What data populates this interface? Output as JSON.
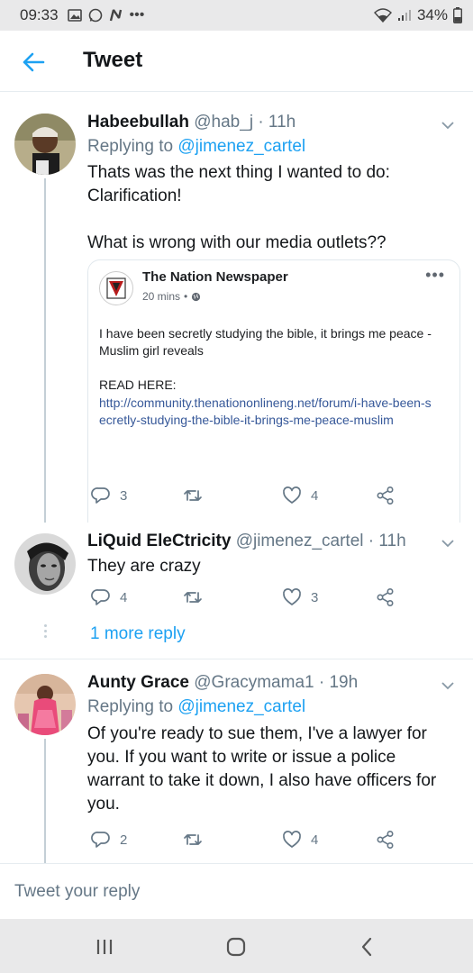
{
  "status_bar": {
    "time": "09:33",
    "battery": "34%"
  },
  "header": {
    "title": "Tweet"
  },
  "tweets": [
    {
      "name": "Habeebullah",
      "handle": "@hab_j",
      "time": "· 11h",
      "replying_prefix": "Replying to ",
      "replying_handle": "@jimenez_cartel",
      "text": "Thats was the next thing I wanted to do: Clarification!\n\nWhat is wrong with our media outlets??",
      "card": {
        "source": "The Nation Newspaper",
        "time": "20 mins",
        "text": "I have been secretly studying the bible, it brings me peace - Muslim girl reveals",
        "read_here": "READ HERE:",
        "link": "http://community.thenationonlineng.net/forum/i-have-been-secretly-studying-the-bible-it-brings-me-peace-muslim"
      },
      "replies": "3",
      "likes": "4"
    },
    {
      "name": "LiQuid EleCtricity",
      "handle": "@jimenez_cartel",
      "time": "· 11h",
      "text": "They are crazy",
      "replies": "4",
      "likes": "3",
      "more_replies": "1 more reply"
    },
    {
      "name": "Aunty Grace",
      "handle": "@Gracymama1",
      "time": "· 19h",
      "replying_prefix": "Replying to ",
      "replying_handle": "@jimenez_cartel",
      "text": "Of you're ready to sue them, I've a lawyer for you. If you want to write or issue a police warrant to take it down, I also have officers for you.",
      "replies": "2",
      "likes": "4"
    }
  ],
  "reply_box": {
    "placeholder": "Tweet your reply"
  },
  "colors": {
    "accent": "#1da1f2",
    "secondary_text": "#657786",
    "primary_text": "#14171a",
    "link": "#365899"
  },
  "icons": [
    "gallery-icon",
    "whatsapp-icon",
    "n-icon",
    "more-icon",
    "wifi-icon",
    "signal-icon",
    "battery-icon",
    "back-arrow-icon",
    "chevron-down-icon",
    "reply-icon",
    "retweet-icon",
    "like-icon",
    "share-icon",
    "globe-icon",
    "recent-apps-icon",
    "home-icon",
    "back-nav-icon"
  ]
}
